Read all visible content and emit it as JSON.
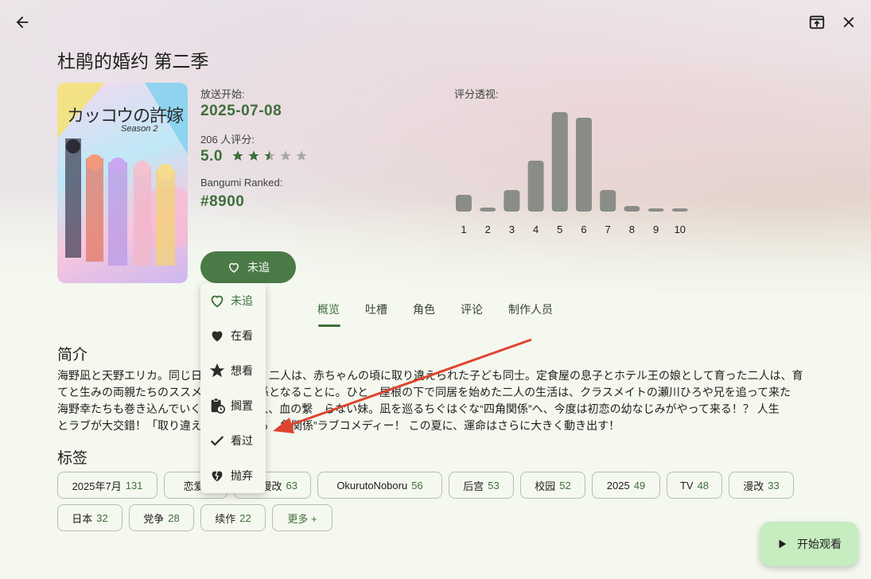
{
  "header": {
    "title": "杜鹃的婚约 第二季",
    "icons": [
      "back-arrow-icon",
      "open-external-icon",
      "close-icon"
    ]
  },
  "cover": {
    "logo_text": "カッコウの許嫁",
    "season_text": "Season 2"
  },
  "info": {
    "air_label": "放送开始:",
    "air_date": "2025-07-08",
    "votes_label": "206 人评分:",
    "score": "5.0",
    "stars": 2.5,
    "rank_label": "Bangumi Ranked:",
    "rank": "#8900"
  },
  "follow_button": {
    "label": "未追",
    "icon": "heart-outline-icon"
  },
  "histogram": {
    "title": "评分透视:",
    "color": "#8a8c88"
  },
  "chart_data": {
    "type": "bar",
    "title": "评分透视:",
    "categories": [
      "1",
      "2",
      "3",
      "4",
      "5",
      "6",
      "7",
      "8",
      "9",
      "10"
    ],
    "values": [
      21,
      5,
      27,
      64,
      125,
      118,
      27,
      7,
      4,
      4
    ]
  },
  "tabs": [
    {
      "label": "概览",
      "active": true
    },
    {
      "label": "吐槽",
      "active": false
    },
    {
      "label": "角色",
      "active": false
    },
    {
      "label": "评论",
      "active": false
    },
    {
      "label": "制作人员",
      "active": false
    }
  ],
  "summary": {
    "title": "简介",
    "lines": [
      "海野凪と天野エリカ。同じ日　　　　　　二人は、赤ちゃんの頃に取り違えられた子ども同士。定食屋の息子とホテル王の娘として育った二人は、育",
      "てと生みの両親たちのススメ　　　　　係となることに。ひと　屋根の下で同居を始めた二人の生活は、クラスメイトの瀬川ひろや兄を追って来た",
      "海野幸たちも巻き込んでいく　　　　い人、血の繋　らない妹。凪を巡るちぐはぐな“四角関係”へ、今度は初恋の幼なじみがやって来る！？ 人生",
      "とラブが大交錯！「取り違え　　　　まる　角関係”ラブコメディー！ この夏に、運命はさらに大きく動き出す！"
    ]
  },
  "tags_section": {
    "title": "标签",
    "tags": [
      {
        "name": "2025年7月",
        "count": "131"
      },
      {
        "name": "恋爱",
        "count": ""
      },
      {
        "name": "漫改",
        "count": "63"
      },
      {
        "name": "OkurutoNoboru",
        "count": "56"
      },
      {
        "name": "后宫",
        "count": "53"
      },
      {
        "name": "校园",
        "count": "52"
      },
      {
        "name": "2025",
        "count": "49"
      },
      {
        "name": "TV",
        "count": "48"
      },
      {
        "name": "漫改",
        "count": "33"
      },
      {
        "name": "日本",
        "count": "32"
      },
      {
        "name": "党争",
        "count": "28"
      },
      {
        "name": "续作",
        "count": "22"
      },
      {
        "name": "更多 +",
        "count": ""
      }
    ]
  },
  "dropdown_menu": {
    "items": [
      {
        "label": "未追",
        "icon": "heart-outline-icon",
        "selected": true
      },
      {
        "label": "在看",
        "icon": "heart-filled-icon",
        "selected": false
      },
      {
        "label": "想看",
        "icon": "star-icon",
        "selected": false
      },
      {
        "label": "搁置",
        "icon": "clipboard-clock-icon",
        "selected": false
      },
      {
        "label": "看过",
        "icon": "check-icon",
        "selected": false
      },
      {
        "label": "抛弃",
        "icon": "heart-broken-icon",
        "selected": false
      }
    ]
  },
  "fab": {
    "label": "开始观看",
    "icon": "play-icon"
  },
  "annotation": {
    "arrow_color": "#e0432f"
  }
}
